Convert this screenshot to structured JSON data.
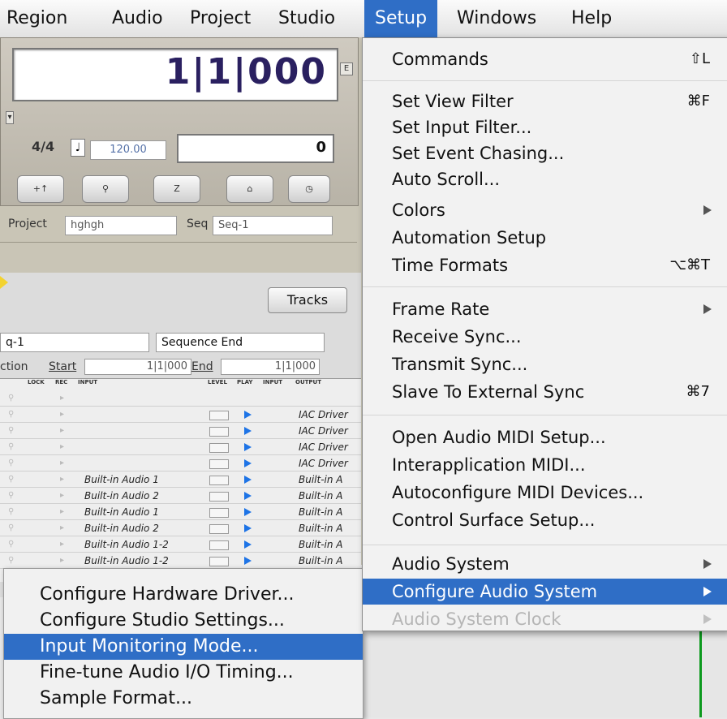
{
  "menubar": {
    "items": [
      "Region",
      "Audio",
      "Project",
      "Studio",
      "Setup",
      "Windows",
      "Help"
    ],
    "active": "Setup"
  },
  "transport": {
    "counter": "1|1|000",
    "tempo": "120.00",
    "sub_counter": "0",
    "project_label": "Project",
    "project_name": "hghgh",
    "seq_label": "Seq",
    "seq_name": "Seq-1"
  },
  "tracks_window": {
    "tracks_button": "Tracks",
    "seq_field": "q-1",
    "sequence_end": "Sequence End",
    "selection_label": "ction",
    "start_label": "Start",
    "start_value": "1|1|000",
    "end_label": "End",
    "end_value": "1|1|000",
    "columns": [
      "LOCK",
      "REC",
      "INPUT",
      "LEVEL",
      "PLAY",
      "INPUT",
      "OUTPUT"
    ],
    "rows": [
      {
        "input": "",
        "output": ""
      },
      {
        "input": "",
        "output": "IAC Driver"
      },
      {
        "input": "",
        "output": "IAC Driver"
      },
      {
        "input": "",
        "output": "IAC Driver"
      },
      {
        "input": "",
        "output": "IAC Driver"
      },
      {
        "input": "Built-in Audio 1",
        "output": "Built-in A"
      },
      {
        "input": "Built-in Audio 2",
        "output": "Built-in A"
      },
      {
        "input": "Built-in Audio 1",
        "output": "Built-in A"
      },
      {
        "input": "Built-in Audio 2",
        "output": "Built-in A"
      },
      {
        "input": "Built-in Audio 1-2",
        "output": "Built-in A"
      },
      {
        "input": "Built-in Audio 1-2",
        "output": "Built-in A"
      }
    ]
  },
  "setup_menu": {
    "items": [
      {
        "label": "Commands",
        "shortcut": "⇧L"
      },
      {
        "label": "Set View Filter",
        "shortcut": "⌘F"
      },
      {
        "label": "Set Input Filter..."
      },
      {
        "label": "Set Event Chasing..."
      },
      {
        "label": "Auto Scroll..."
      },
      {
        "label": "Colors"
      },
      {
        "label": "Automation Setup"
      },
      {
        "label": "Time Formats",
        "shortcut": "⌥⌘T"
      },
      {
        "label": "Frame Rate"
      },
      {
        "label": "Receive Sync..."
      },
      {
        "label": "Transmit Sync..."
      },
      {
        "label": "Slave To External Sync",
        "shortcut": "⌘7"
      },
      {
        "label": "Open Audio MIDI Setup..."
      },
      {
        "label": "Interapplication MIDI..."
      },
      {
        "label": "Autoconfigure MIDI Devices..."
      },
      {
        "label": "Control Surface Setup..."
      },
      {
        "label": "Audio System"
      },
      {
        "label": "Configure Audio System"
      },
      {
        "label": "Audio System Clock"
      }
    ]
  },
  "submenu": {
    "items": [
      "Configure Hardware Driver...",
      "Configure Studio Settings...",
      "Input Monitoring Mode...",
      "Fine-tune Audio I/O Timing...",
      "Sample Format..."
    ],
    "highlighted": "Input Monitoring Mode..."
  },
  "colors": {
    "highlight": "#2f6ec6",
    "play_arrow": "#1e74e6"
  }
}
